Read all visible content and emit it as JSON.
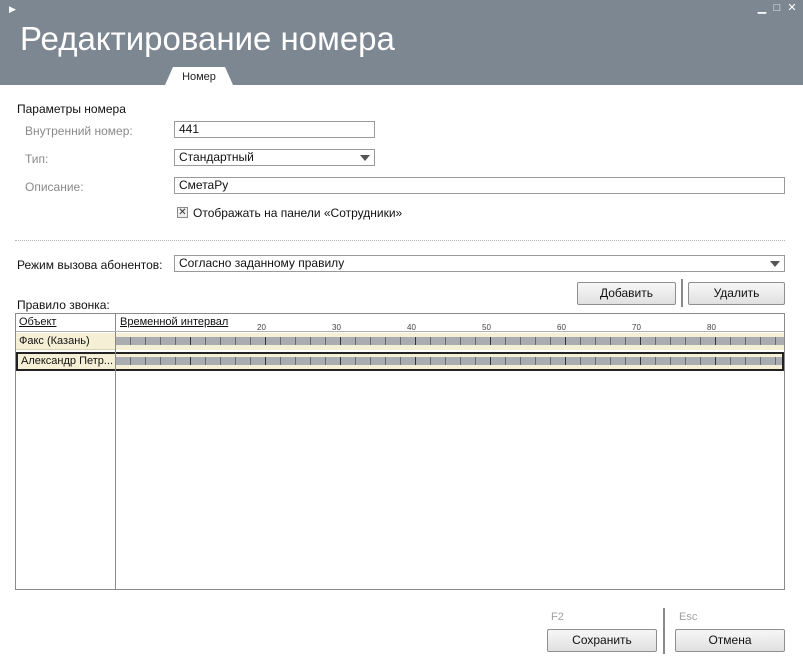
{
  "window": {
    "title": "Редактирование номера",
    "controls": [
      "▁",
      "□",
      "✕"
    ]
  },
  "tabs": [
    {
      "label": "Номер",
      "active": true
    }
  ],
  "params": {
    "section_title": "Параметры номера",
    "internal_label": "Внутренний номер:",
    "internal_value": "441",
    "type_label": "Тип:",
    "type_value": "Стандартный",
    "description_label": "Описание:",
    "description_value": "СметаРу",
    "show_checkbox_label": "Отображать на панели «Сотрудники»",
    "show_checkbox_checked": true
  },
  "call_mode": {
    "label": "Режим вызова абонентов:",
    "value": "Согласно заданному правилу"
  },
  "rule": {
    "label": "Правило звонка:",
    "add_button": "Добавить",
    "delete_button": "Удалить",
    "columns": [
      "Объект",
      "Временной интервал"
    ],
    "ticks": [
      "20",
      "30",
      "40",
      "50",
      "60",
      "70",
      "80"
    ],
    "rows": [
      {
        "object": "Факс (Казань)",
        "selected": false
      },
      {
        "object": "Александр Петр...",
        "selected": true
      }
    ]
  },
  "footer": {
    "save_key": "F2",
    "save_button": "Сохранить",
    "cancel_key": "Esc",
    "cancel_button": "Отмена"
  },
  "colors": {
    "header": "#7d8792",
    "row_highlight": "#f5f0d5",
    "bar": "#a9adb2"
  }
}
